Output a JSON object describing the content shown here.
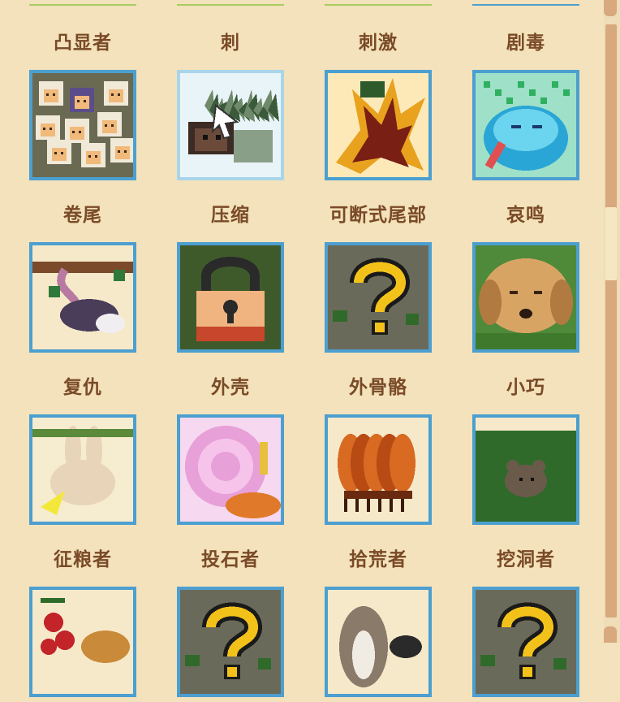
{
  "colors": {
    "background": "#f3e2bb",
    "label_text": "#7a4a28",
    "icon_border": "#4c9fd0",
    "selected_border": "#a9d5ea",
    "top_line_green": "#a8cc62",
    "top_line_blue": "#4c9fd0"
  },
  "traits": [
    {
      "label": "凸显者",
      "icon": "sheep-crowd-icon",
      "selected": false
    },
    {
      "label": "刺",
      "icon": "hedgehog-spines-icon",
      "selected": true
    },
    {
      "label": "刺激",
      "icon": "spiky-plant-icon",
      "selected": false
    },
    {
      "label": "剧毒",
      "icon": "poison-frog-icon",
      "selected": false
    },
    {
      "label": "卷尾",
      "icon": "opossum-tail-icon",
      "selected": false
    },
    {
      "label": "压缩",
      "icon": "padlock-icon",
      "selected": false
    },
    {
      "label": "可断式尾部",
      "icon": "question-mark-icon",
      "selected": false
    },
    {
      "label": "哀鸣",
      "icon": "sad-dog-icon",
      "selected": false
    },
    {
      "label": "复仇",
      "icon": "rabbit-icon",
      "selected": false
    },
    {
      "label": "外壳",
      "icon": "snail-shell-icon",
      "selected": false
    },
    {
      "label": "外骨骼",
      "icon": "armored-bug-icon",
      "selected": false
    },
    {
      "label": "小巧",
      "icon": "small-mouse-icon",
      "selected": false
    },
    {
      "label": "征粮者",
      "icon": "berries-icon",
      "selected": false
    },
    {
      "label": "投石者",
      "icon": "question-mark-icon",
      "selected": false
    },
    {
      "label": "拾荒者",
      "icon": "raccoon-icon",
      "selected": false
    },
    {
      "label": "挖洞者",
      "icon": "question-mark-icon",
      "selected": false
    }
  ]
}
